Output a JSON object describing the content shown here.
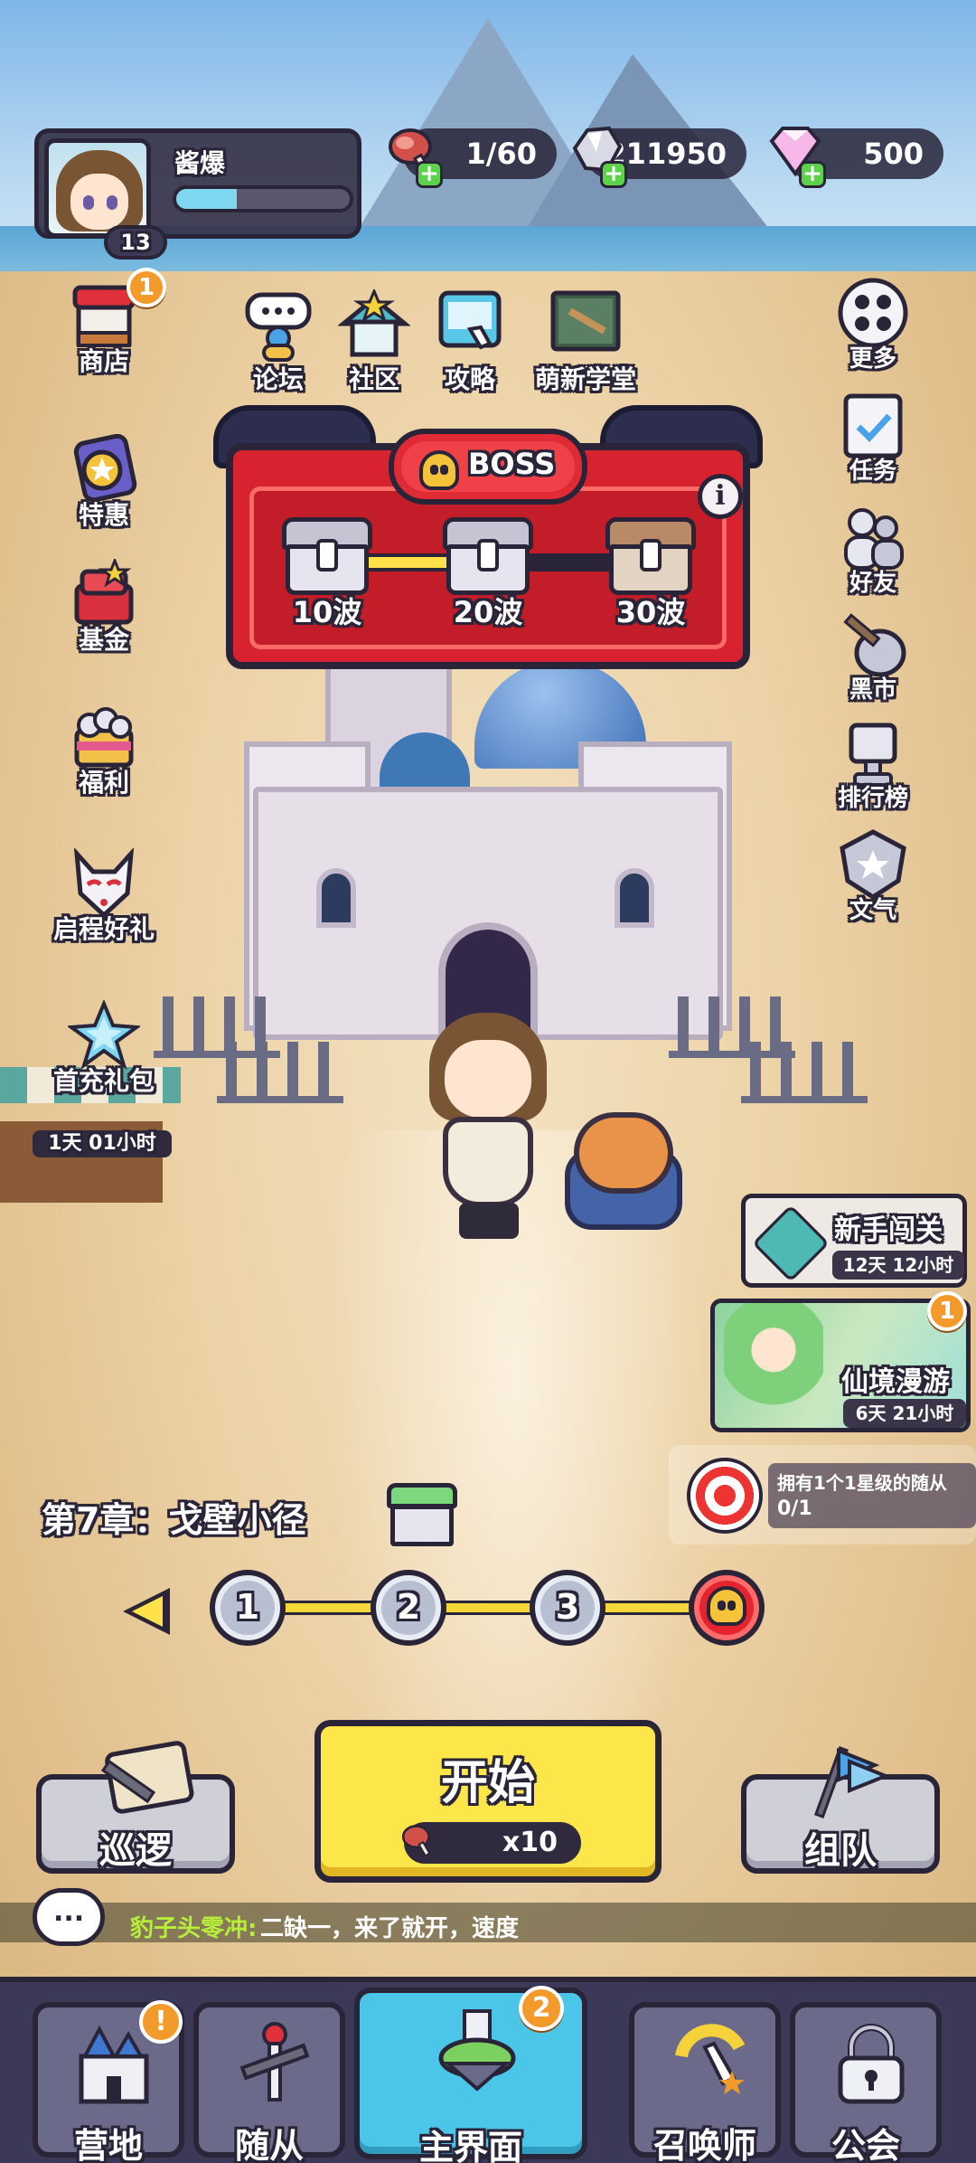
{
  "player": {
    "name": "酱爆",
    "level": "13",
    "exp_fraction": 0.35
  },
  "resources": [
    {
      "icon": "meat-icon",
      "value": "1/60"
    },
    {
      "icon": "silver-crystal-icon",
      "value": "211950"
    },
    {
      "icon": "diamond-icon",
      "value": "500"
    }
  ],
  "top_links": [
    {
      "label": "论坛",
      "icon": "forum-icon"
    },
    {
      "label": "社区",
      "icon": "community-icon"
    },
    {
      "label": "攻略",
      "icon": "guide-icon"
    },
    {
      "label": "萌新学堂",
      "icon": "newbie-school-icon"
    }
  ],
  "left_menu": [
    {
      "label": "商店",
      "icon": "shop-icon",
      "badge": "1"
    },
    {
      "label": "特惠",
      "icon": "special-offer-icon"
    },
    {
      "label": "基金",
      "icon": "fund-icon"
    },
    {
      "label": "福利",
      "icon": "welfare-icon"
    },
    {
      "label": "启程好礼",
      "icon": "fox-mask-icon"
    },
    {
      "label": "首充礼包",
      "icon": "first-charge-icon",
      "timer": "1天 01小时"
    }
  ],
  "right_menu": [
    {
      "label": "更多",
      "icon": "more-icon"
    },
    {
      "label": "任务",
      "icon": "task-icon"
    },
    {
      "label": "好友",
      "icon": "friends-icon"
    },
    {
      "label": "黑市",
      "icon": "black-market-icon"
    },
    {
      "label": "排行榜",
      "icon": "ranking-icon"
    },
    {
      "label": "文气",
      "icon": "culture-icon"
    }
  ],
  "boss_panel": {
    "title": "BOSS",
    "info": "i",
    "progress_fraction": 0.45,
    "rewards": [
      {
        "label": "10波"
      },
      {
        "label": "20波"
      },
      {
        "label": "30波"
      }
    ]
  },
  "events": {
    "newbie": {
      "title": "新手闯关",
      "timer": "12天 12小时"
    },
    "roam": {
      "title": "仙境漫游",
      "timer": "6天 21小时",
      "badge": "1"
    },
    "quest": {
      "text": "拥有1个1星级的随从",
      "progress": "0/1"
    }
  },
  "chapter": {
    "title": "第7章：戈壁小径",
    "stages": [
      "1",
      "2",
      "3"
    ]
  },
  "buttons": {
    "patrol": "巡逻",
    "start": "开始",
    "start_cost": "x10",
    "team": "组队"
  },
  "chat": {
    "name": "豹子头零冲:",
    "message": "二缺一，来了就开，速度"
  },
  "nav": [
    {
      "label": "营地",
      "icon": "camp-castle-icon",
      "alert": "!"
    },
    {
      "label": "随从",
      "icon": "followers-icon"
    },
    {
      "label": "主界面",
      "icon": "main-island-icon",
      "badge": "2"
    },
    {
      "label": "召唤师",
      "icon": "summoner-icon"
    },
    {
      "label": "公会",
      "icon": "guild-lock-icon"
    }
  ],
  "colors": {
    "boss_red": "#d8222f",
    "start_yellow": "#fde64a",
    "nav_active": "#4cc6e8",
    "accent_orange": "#f39a2b"
  }
}
